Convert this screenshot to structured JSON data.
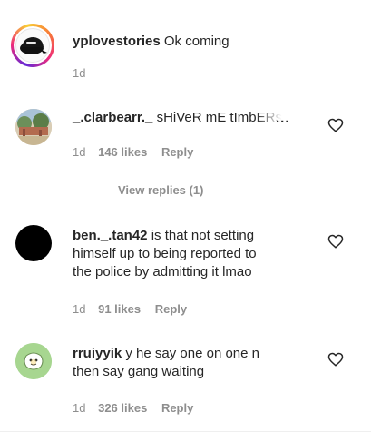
{
  "top_comment": {
    "username": "yplovestories",
    "text": "Ok coming",
    "time": "1d"
  },
  "comments": [
    {
      "username": "_.clarbearr._",
      "text": "sHiVeR mE tImbERs",
      "time": "1d",
      "likes": "146 likes",
      "reply": "Reply",
      "more": "..."
    },
    {
      "username": "ben._.tan42",
      "text_line1": "is that not setting",
      "text_line2": "himself up to being reported to",
      "text_line3": "the police by admitting it lmao",
      "time": "1d",
      "likes": "91 likes",
      "reply": "Reply"
    },
    {
      "username": "rruiyyik",
      "text_line1": "y he say one on one n",
      "text_line2": "then say gang waiting",
      "time": "1d",
      "likes": "326 likes",
      "reply": "Reply"
    }
  ],
  "view_replies": "View replies (1)",
  "colors": {
    "story_ring_start": "#f9ce34",
    "story_ring_mid": "#ee2a7b",
    "story_ring_end": "#6228d7",
    "secondary_text": "#8e8e8e",
    "divider": "#dbdbdb"
  },
  "icons": [
    "heart-icon",
    "more-icon"
  ]
}
